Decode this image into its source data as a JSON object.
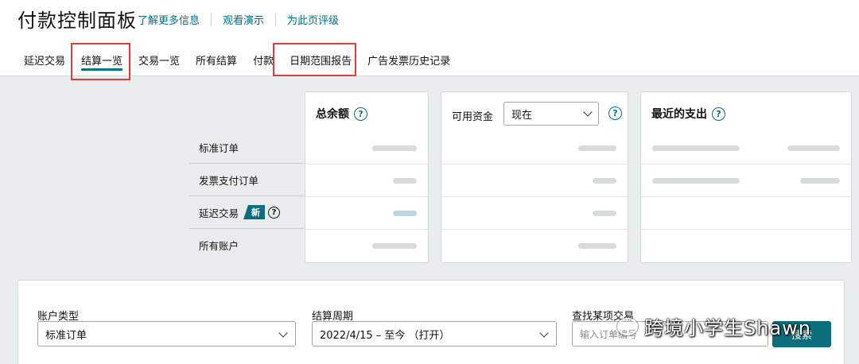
{
  "header": {
    "title": "付款控制面板",
    "links": [
      "了解更多信息",
      "观看演示",
      "为此页评级"
    ]
  },
  "tabs": [
    "延迟交易",
    "结算一览",
    "交易一览",
    "所有结算",
    "付款",
    "日期范围报告",
    "广告发票历史记录"
  ],
  "active_tab": "结算一览",
  "summary": {
    "row_labels": [
      "标准订单",
      "发票支付订单",
      "延迟交易",
      "所有账户"
    ],
    "new_badge": "新",
    "total_balance": {
      "title": "总余额"
    },
    "available_funds": {
      "label": "可用资金",
      "select_value": "现在"
    },
    "recent_payout": {
      "title": "最近的支出"
    }
  },
  "filters": {
    "account_type": {
      "label": "账户类型",
      "value": "标准订单"
    },
    "settlement_period": {
      "label": "结算周期",
      "value": "2022/4/15 – 至今 （打开）"
    },
    "find_transaction": {
      "label": "查找某项交易",
      "placeholder": "输入订单编号"
    },
    "search_button": "搜索"
  },
  "watermark": "跨境小学生Shawn",
  "colors": {
    "accent": "#007185",
    "badge": "#0c6d7c",
    "highlight": "#e03a3a"
  }
}
